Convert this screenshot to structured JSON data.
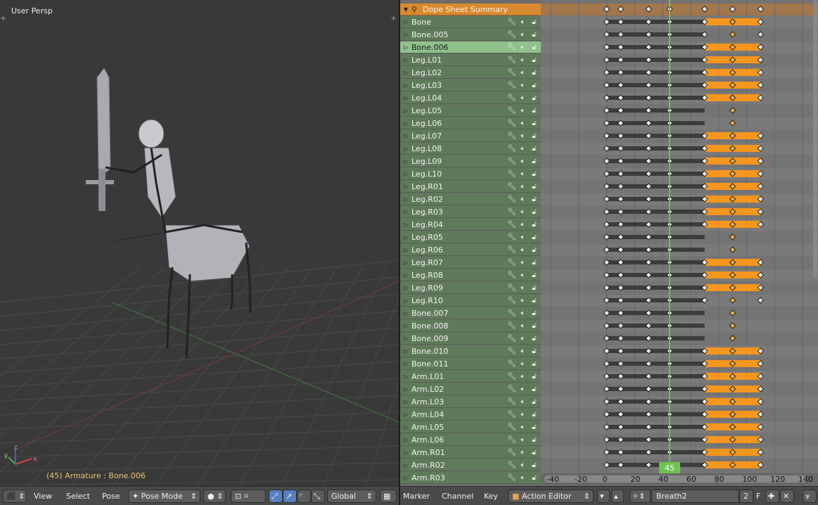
{
  "viewport": {
    "view_label": "User Persp",
    "object_info": "(45) Armature : Bone.006"
  },
  "dopesheet": {
    "summary_label": "Dope Sheet Summary",
    "channels": [
      "Bone",
      "Bone.005",
      "Bone.006",
      "Leg.L01",
      "Leg.L02",
      "Leg.L03",
      "Leg.L04",
      "Leg.L05",
      "Leg.L06",
      "Leg.L07",
      "Leg.L08",
      "Leg.L09",
      "Leg.L10",
      "Leg.R01",
      "Leg.R02",
      "Leg.R03",
      "Leg.R04",
      "Leg.R05",
      "Leg.R06",
      "Leg.R07",
      "Leg.R08",
      "Leg.R09",
      "Leg.R10",
      "Bone.007",
      "Bone.008",
      "Bone.009",
      "Bone.010",
      "Bone.011",
      "Arm.L01",
      "Arm.L02",
      "Arm.L03",
      "Arm.L04",
      "Arm.L05",
      "Arm.L06",
      "Arm.R01",
      "Arm.R02",
      "Arm.R03"
    ],
    "selected_channel": "Bone.006",
    "frame_ticks": [
      "-40",
      "-20",
      "0",
      "20",
      "40",
      "60",
      "80",
      "100",
      "120",
      "140"
    ],
    "current_frame": "45"
  },
  "header_left": {
    "menus": [
      "View",
      "Select",
      "Pose"
    ],
    "mode": "Pose Mode",
    "orientation": "Global"
  },
  "header_right": {
    "menus": [
      "Marker",
      "Channel",
      "Key"
    ],
    "editor_mode": "Action Editor",
    "action_name": "Breath2",
    "users": "2",
    "fake_user": "F"
  },
  "colors": {
    "channel_bg": "#5f7a5a",
    "channel_selected": "#8fc28a",
    "summary": "#d98a2e",
    "hold_orange": "#f5961e",
    "current_frame": "#6ec24f"
  }
}
